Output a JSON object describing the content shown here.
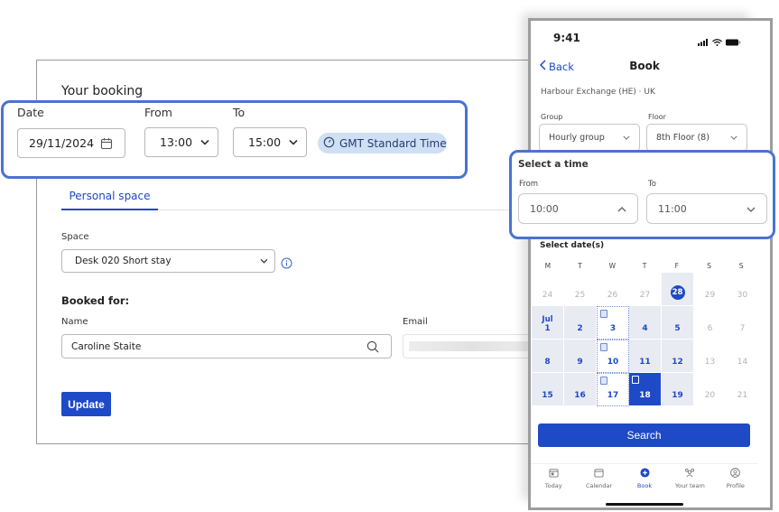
{
  "desktop": {
    "title": "Your booking",
    "date": {
      "label": "Date",
      "value": "29/11/2024",
      "icon": "calendar-icon"
    },
    "from": {
      "label": "From",
      "value": "13:00",
      "icon": "chevron-down-icon"
    },
    "to": {
      "label": "To",
      "value": "15:00",
      "icon": "chevron-down-icon"
    },
    "timezone": {
      "label": "GMT Standard Time",
      "icon": "clock-icon"
    },
    "tabs": [
      {
        "label": "Personal space",
        "active": true
      }
    ],
    "space": {
      "label": "Space",
      "value": "Desk 020 Short stay",
      "icon": "info-icon"
    },
    "booked_for": {
      "heading": "Booked for:",
      "name_label": "Name",
      "name_value": "Caroline Staite",
      "email_label": "Email",
      "email_value": ""
    },
    "update_label": "Update",
    "accent_color": "#1e49c7",
    "highlight_color": "#4a72d0"
  },
  "phone": {
    "status": {
      "time": "9:41",
      "icons": [
        "signal-icon",
        "wifi-icon",
        "battery-icon"
      ]
    },
    "nav": {
      "back_label": "Back",
      "title": "Book"
    },
    "location": "Harbour Exchange (HE) · UK",
    "group": {
      "label": "Group",
      "value": "Hourly group"
    },
    "floor": {
      "label": "Floor",
      "value": "8th Floor (8)"
    },
    "select_time": {
      "title": "Select a time",
      "from_label": "From",
      "from_value": "10:00",
      "to_label": "To",
      "to_value": "11:00"
    },
    "select_dates": {
      "title": "Select date(s)",
      "weekdays": [
        "M",
        "T",
        "W",
        "T",
        "F",
        "S",
        "S"
      ],
      "weeks": [
        [
          {
            "d": "24",
            "s": "muted"
          },
          {
            "d": "25",
            "s": "muted"
          },
          {
            "d": "26",
            "s": "muted"
          },
          {
            "d": "27",
            "s": "muted"
          },
          {
            "d": "28",
            "s": "today"
          },
          {
            "d": "29",
            "s": "muted"
          },
          {
            "d": "30",
            "s": "muted"
          }
        ],
        [
          {
            "d": "1",
            "s": "bg",
            "month": "Jul"
          },
          {
            "d": "2",
            "s": "bg"
          },
          {
            "d": "3",
            "s": "dotted",
            "badge": true
          },
          {
            "d": "4",
            "s": "bg"
          },
          {
            "d": "5",
            "s": "bg"
          },
          {
            "d": "6",
            "s": "muted"
          },
          {
            "d": "7",
            "s": "muted"
          }
        ],
        [
          {
            "d": "8",
            "s": "bg"
          },
          {
            "d": "9",
            "s": "bg"
          },
          {
            "d": "10",
            "s": "dotted",
            "badge": true
          },
          {
            "d": "11",
            "s": "bg"
          },
          {
            "d": "12",
            "s": "bg"
          },
          {
            "d": "13",
            "s": "muted"
          },
          {
            "d": "14",
            "s": "muted"
          }
        ],
        [
          {
            "d": "15",
            "s": "bg"
          },
          {
            "d": "16",
            "s": "bg"
          },
          {
            "d": "17",
            "s": "dotted",
            "badge": true
          },
          {
            "d": "18",
            "s": "selected",
            "badge": true
          },
          {
            "d": "19",
            "s": "bg"
          },
          {
            "d": "20",
            "s": "muted"
          },
          {
            "d": "21",
            "s": "muted"
          }
        ]
      ]
    },
    "search_label": "Search",
    "tab_bar": [
      {
        "label": "Today",
        "icon": "today-icon",
        "active": false
      },
      {
        "label": "Calendar",
        "icon": "calendar-icon",
        "active": false
      },
      {
        "label": "Book",
        "icon": "plus-circle-icon",
        "active": true
      },
      {
        "label": "Your team",
        "icon": "team-icon",
        "active": false
      },
      {
        "label": "Profile",
        "icon": "profile-icon",
        "active": false
      }
    ]
  }
}
